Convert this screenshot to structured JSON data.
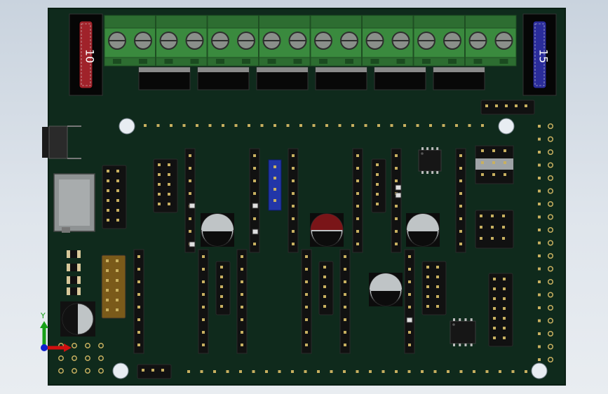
{
  "viewport": {
    "name": "3d-viewport"
  },
  "board": {
    "colors": {
      "pcb": "#0f2a1c",
      "pcb_edge": "#0a1f14",
      "terminal": "#3a8a3e",
      "terminal_dark": "#2d6d31",
      "screw": "#8a8f8a",
      "header": "#111111",
      "pin": "#c8b060",
      "fuse_red": "#a0222a",
      "fuse_blue": "#2a2c9a",
      "jumper_blue": "#2236a8",
      "cap_red": "#7a1518",
      "cap_silver": "#bfc4c6",
      "amber_header": "#7a5a1a",
      "mounting_hole": "#e8edf2"
    },
    "fuses": [
      {
        "id": "fuse-left",
        "label": "10",
        "color_key": "fuse_red"
      },
      {
        "id": "fuse-right",
        "label": "15",
        "color_key": "fuse_blue"
      }
    ],
    "terminal_blocks": 8
  },
  "triad": {
    "y_label": "Y",
    "colors": {
      "x": "#d01010",
      "y": "#18a018",
      "z": "#1020d0"
    }
  }
}
